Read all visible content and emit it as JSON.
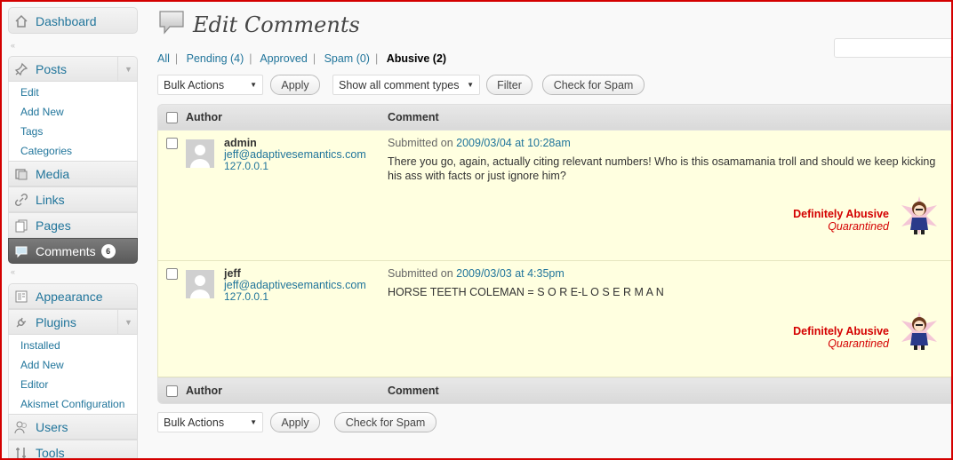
{
  "sidebar": {
    "dashboard": "Dashboard",
    "posts": "Posts",
    "posts_items": [
      "Edit",
      "Add New",
      "Tags",
      "Categories"
    ],
    "media": "Media",
    "links": "Links",
    "pages": "Pages",
    "comments": "Comments",
    "comments_count": "6",
    "appearance": "Appearance",
    "plugins": "Plugins",
    "plugins_items": [
      "Installed",
      "Add New",
      "Editor",
      "Akismet Configuration"
    ],
    "users": "Users",
    "tools": "Tools"
  },
  "page": {
    "title": "Edit Comments"
  },
  "filters": {
    "all": "All",
    "pending": "Pending (4)",
    "approved": "Approved",
    "spam": "Spam (0)",
    "abusive": "Abusive (2)"
  },
  "toolbar": {
    "bulk_actions": "Bulk Actions",
    "apply": "Apply",
    "comment_types": "Show all comment types",
    "filter": "Filter",
    "check_spam": "Check for Spam"
  },
  "table": {
    "col_author": "Author",
    "col_comment": "Comment",
    "submitted_prefix": "Submitted on",
    "rows": [
      {
        "name": "admin",
        "email": "jeff@adaptivesemantics.com",
        "ip": "127.0.0.1",
        "date": "2009/03/04 at 10:28am",
        "text": "There you go, again, actually citing relevant numbers! Who is this osamamania troll and should we keep kicking his ass with facts or just ignore him?",
        "label": "Definitely Abusive",
        "status": "Quarantined"
      },
      {
        "name": "jeff",
        "email": "jeff@adaptivesemantics.com",
        "ip": "127.0.0.1",
        "date": "2009/03/03 at 4:35pm",
        "text": "HORSE TEETH COLEMAN = S O R E-L O S E R M A N",
        "label": "Definitely Abusive",
        "status": "Quarantined"
      }
    ]
  },
  "colors": {
    "accent": "#21759b",
    "abusive": "#d40000",
    "row_bg": "#ffffe0"
  }
}
